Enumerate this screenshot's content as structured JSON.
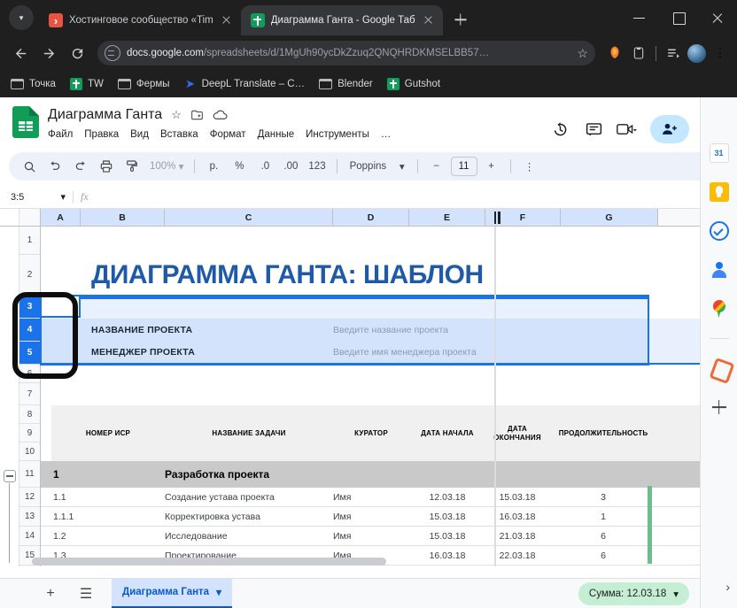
{
  "browser": {
    "tabs": [
      {
        "title": "Хостинговое сообщество «Tim",
        "favicon": "rss-icon",
        "active": false
      },
      {
        "title": "Диаграмма Ганта - Google Таб",
        "favicon": "sheets-icon",
        "active": true
      }
    ],
    "new_tab_label": "+",
    "url_domain": "docs.google.com",
    "url_path": "/spreadsheets/d/1MgUh90ycDkZzuq2QNQHRDKMSELBB57…",
    "bookmarks": [
      {
        "label": "Точка",
        "icon": "folder-icon"
      },
      {
        "label": "TW",
        "icon": "sheets-icon"
      },
      {
        "label": "Фермы",
        "icon": "folder-icon"
      },
      {
        "label": "DeepL Translate – C…",
        "icon": "deepl-icon"
      },
      {
        "label": "Blender",
        "icon": "folder-icon"
      },
      {
        "label": "Gutshot",
        "icon": "sheets-icon"
      }
    ]
  },
  "docs": {
    "title": "Диаграмма Ганта",
    "menu": [
      "Файл",
      "Правка",
      "Вид",
      "Вставка",
      "Формат",
      "Данные",
      "Инструменты",
      "…"
    ],
    "toolbar": {
      "zoom": "100%",
      "currency": "р.",
      "percent": "%",
      "dec_less": ".0",
      "dec_more": ".00",
      "formats": "123",
      "font": "Poppins",
      "font_size": "11",
      "minus": "−",
      "plus": "+",
      "more": "⋮"
    },
    "name_box": "3:5",
    "fx_label": "fx"
  },
  "grid": {
    "columns": [
      "A",
      "B",
      "C",
      "D",
      "E",
      "F",
      "G"
    ],
    "rows": [
      "1",
      "2",
      "3",
      "4",
      "5",
      "6",
      "7",
      "8",
      "9",
      "10",
      "11",
      "12",
      "13",
      "14",
      "15"
    ],
    "selected_rows": [
      "3",
      "4",
      "5"
    ],
    "sheet_title": "ДИАГРАММА ГАНТА: ШАБЛОН",
    "info_rows": [
      {
        "label": "НАЗВАНИЕ ПРОЕКТА",
        "value": "Введите название проекта"
      },
      {
        "label": "МЕНЕДЖЕР ПРОЕКТА",
        "value": "Введите имя менеджера проекта"
      }
    ],
    "table_headers": [
      "НОМЕР ИСР",
      "НАЗВАНИЕ ЗАДАЧИ",
      "КУРАТОР",
      "ДАТА НАЧАЛА",
      "ДАТА ОКОНЧАНИЯ",
      "ПРОДОЛЖИТЕЛЬНОСТЬ"
    ],
    "group_row": {
      "number": "1",
      "name": "Разработка проекта"
    },
    "task_rows": [
      {
        "wbs": "1.1",
        "name": "Создание устава проекта",
        "owner": "Имя",
        "start": "12.03.18",
        "end": "15.03.18",
        "duration": "3"
      },
      {
        "wbs": "1.1.1",
        "name": "Корректировка устава",
        "owner": "Имя",
        "start": "15.03.18",
        "end": "16.03.18",
        "duration": "1"
      },
      {
        "wbs": "1.2",
        "name": "Исследование",
        "owner": "Имя",
        "start": "15.03.18",
        "end": "21.03.18",
        "duration": "6"
      },
      {
        "wbs": "1.3",
        "name": "Проектирование",
        "owner": "Имя",
        "start": "16.03.18",
        "end": "22.03.18",
        "duration": "6"
      }
    ]
  },
  "bottom": {
    "add_sheet": "+",
    "all_sheets": "☰",
    "sheet_tab": "Диаграмма Ганта",
    "sheet_tab_caret": "▾",
    "sum_chip": "Сумма: 12.03.18",
    "sum_caret": "▾"
  },
  "sidepanel": {
    "icons": [
      "calendar-icon",
      "keep-icon",
      "tasks-icon",
      "contacts-icon",
      "maps-icon",
      "orange-app-icon",
      "add-apps-icon"
    ],
    "expand": "›"
  },
  "colors": {
    "accent_blue": "#1a73e8",
    "title_blue": "#1f5aa8",
    "sheets_green": "#0f9d58",
    "sum_chip_green": "#c5eed4",
    "group_gray": "#c9c9c9"
  }
}
